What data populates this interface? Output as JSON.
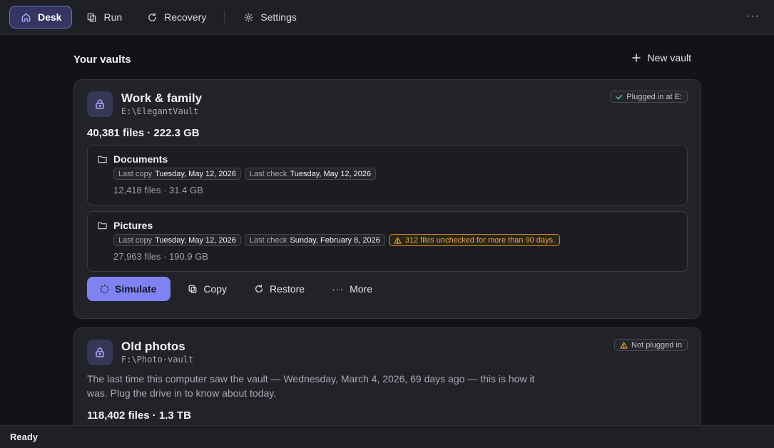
{
  "nav": {
    "items": [
      {
        "label": "Desk",
        "icon": "home-icon",
        "active": true
      },
      {
        "label": "Run",
        "icon": "copy-icon"
      },
      {
        "label": "Recovery",
        "icon": "refresh-icon"
      },
      {
        "label": "Settings",
        "icon": "gear-icon"
      }
    ],
    "more_icon": "ellipsis-icon"
  },
  "main": {
    "section_title": "Your vaults",
    "new_vault_label": "New vault"
  },
  "vaults": [
    {
      "name": "Work & family",
      "path": "E:\\ElegantVault",
      "status": "Plugged in at E:",
      "totals": "40,381 files · 222.3 GB",
      "folders": [
        {
          "name": "Documents",
          "last_copy_label": "Last copy",
          "last_copy": "Tuesday, May 12, 2026",
          "last_check_label": "Last check",
          "last_check": "Tuesday, May 12, 2026",
          "stats": "12,418 files · 31.4 GB"
        },
        {
          "name": "Pictures",
          "last_copy_label": "Last copy",
          "last_copy": "Tuesday, May 12, 2026",
          "last_check_label": "Last check",
          "last_check": "Sunday, February 8, 2026",
          "warning": "312 files unchecked for more than 90 days.",
          "stats": "27,963 files · 190.9 GB"
        }
      ],
      "actions": {
        "simulate": "Simulate",
        "copy": "Copy",
        "restore": "Restore",
        "more": "More"
      }
    },
    {
      "name": "Old photos",
      "path": "F:\\Photo-vault",
      "status": "Not plugged in",
      "last_seen": "The last time this computer saw the vault — Wednesday, March 4, 2026, 69 days ago — this is how it was. Plug the drive in to know about today.",
      "totals": "118,402 files · 1.3 TB"
    }
  ],
  "statusbar": {
    "text": "Ready"
  },
  "colors": {
    "accent": "#7f83f0",
    "success": "#4fbf7a",
    "warning": "#e7a33a"
  }
}
